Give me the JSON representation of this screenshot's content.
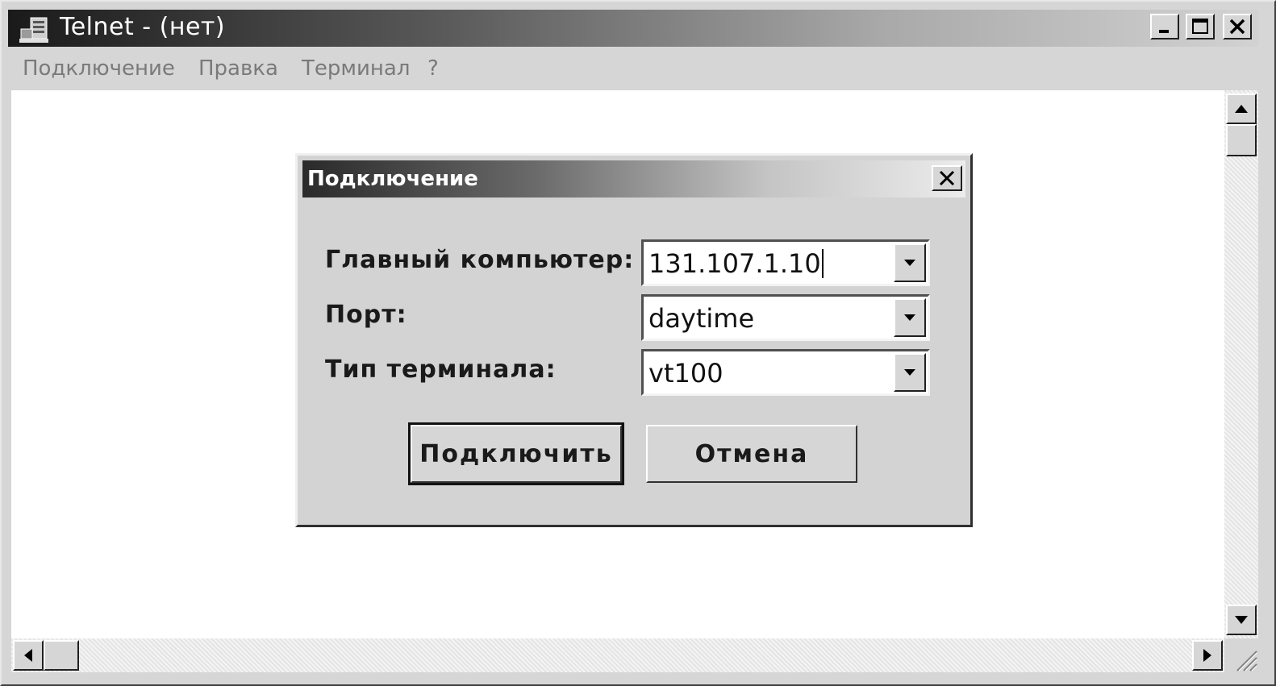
{
  "window": {
    "title": "Telnet - (нет)",
    "icon": "telnet-computer-icon",
    "controls": [
      "minimize-icon",
      "maximize-icon",
      "close-icon"
    ]
  },
  "menu": {
    "items": [
      {
        "label": "Подключение"
      },
      {
        "label": "Правка"
      },
      {
        "label": "Терминал"
      },
      {
        "label": "?"
      }
    ]
  },
  "dialog": {
    "title": "Подключение",
    "fields": {
      "host": {
        "label": "Главный компьютер:",
        "value": "131.107.1.10"
      },
      "port": {
        "label": "Порт:",
        "value": "daytime"
      },
      "terminal": {
        "label": "Тип терминала:",
        "value": "vt100"
      }
    },
    "buttons": {
      "connect": "Подключить",
      "cancel": "Отмена"
    }
  },
  "colors": {
    "face": "#d6d6d6",
    "client": "#ffffff",
    "titlebar_dark": "#1a1a1a"
  }
}
